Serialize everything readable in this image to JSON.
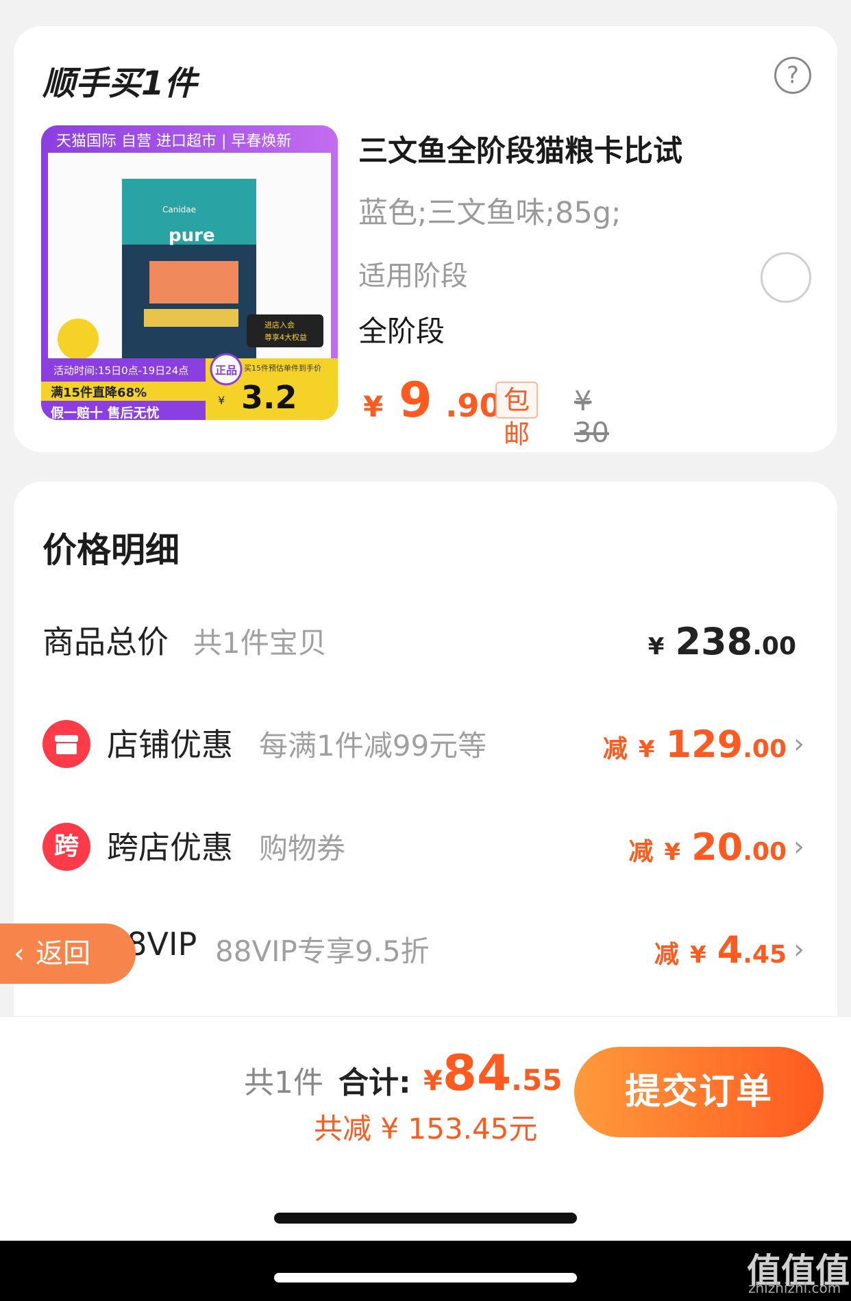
{
  "upsell": {
    "title": "顺手买1件",
    "help_icon": "question-circle-icon",
    "product": {
      "name": "三文鱼全阶段猫粮卡比试",
      "spec": "蓝色;三文鱼味;85g;",
      "stage_label": "适用阶段",
      "stage_value": "全阶段",
      "price_symbol": "¥",
      "price_int": "9",
      "price_dec": ".90",
      "shipping_tag": "包邮",
      "original_price": "¥ 30",
      "image": {
        "banner_text": "天猫国际 自营 进口超市 | 早春焕新",
        "brand": "Canidae",
        "product_text": "pure",
        "activity_time": "活动时间:15日0点-19日24点",
        "discount_text": "满15件直降68%",
        "guarantee_text": "假一赔十 售后无忧",
        "authentic_badge": "正品",
        "estimate_label": "买15件预估单件到手价",
        "estimate_symbol": "¥",
        "estimate_price": "3.2",
        "member_text_1": "进店入会",
        "member_text_2": "尊享4大权益"
      }
    }
  },
  "price_detail": {
    "title": "价格明细",
    "total_row": {
      "label": "商品总价",
      "sub": "共1件宝贝",
      "cur": "¥",
      "int": "238",
      "dec": ".00"
    },
    "discounts": [
      {
        "icon": "store-icon",
        "icon_glyph": "",
        "label": "店铺优惠",
        "sub": "每满1件减99元等",
        "prefix": "减",
        "cur": "¥",
        "int": "129",
        "dec": ".00"
      },
      {
        "icon": "cross-store-icon",
        "icon_glyph": "跨",
        "label": "跨店优惠",
        "sub": "购物券",
        "prefix": "减",
        "cur": "¥",
        "int": "20",
        "dec": ".00"
      },
      {
        "icon": "vip-icon",
        "icon_glyph": "88",
        "label": "88VIP",
        "sub": "88VIP专享9.5折",
        "prefix": "减",
        "cur": "¥",
        "int": "4",
        "dec": ".45"
      }
    ]
  },
  "back_button": {
    "label": "返回"
  },
  "footer": {
    "count": "共1件",
    "total_label": "合计:",
    "total_cur": "¥",
    "total_int": "84",
    "total_dec": ".55",
    "saved": "共减 ¥ 153.45元",
    "submit_label": "提交订单"
  },
  "watermark": {
    "text": "值值值",
    "url": "zhizhizhi.com"
  },
  "colors": {
    "accent": "#ff5a1f",
    "icon_red": "#ff3b4a",
    "bg": "#f2f2f2"
  }
}
